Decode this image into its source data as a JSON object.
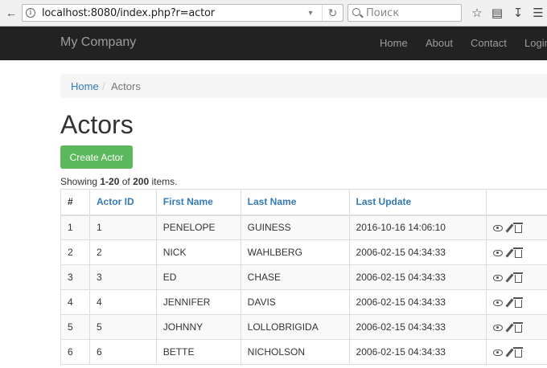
{
  "browser": {
    "url": "localhost:8080/index.php?r=actor",
    "search_placeholder": "Поиск"
  },
  "navbar": {
    "brand": "My Company",
    "links": [
      "Home",
      "About",
      "Contact",
      "Login"
    ]
  },
  "breadcrumb": {
    "home": "Home",
    "separator": "/",
    "active": "Actors"
  },
  "page": {
    "title": "Actors",
    "create_button": "Create Actor"
  },
  "summary": {
    "prefix": "Showing ",
    "range": "1-20",
    "middle": " of ",
    "total": "200",
    "suffix": " items."
  },
  "table": {
    "headers": [
      "#",
      "Actor ID",
      "First Name",
      "Last Name",
      "Last Update",
      ""
    ],
    "rows": [
      [
        "1",
        "1",
        "PENELOPE",
        "GUINESS",
        "2016-10-16 14:06:10"
      ],
      [
        "2",
        "2",
        "NICK",
        "WAHLBERG",
        "2006-02-15 04:34:33"
      ],
      [
        "3",
        "3",
        "ED",
        "CHASE",
        "2006-02-15 04:34:33"
      ],
      [
        "4",
        "4",
        "JENNIFER",
        "DAVIS",
        "2006-02-15 04:34:33"
      ],
      [
        "5",
        "5",
        "JOHNNY",
        "LOLLOBRIGIDA",
        "2006-02-15 04:34:33"
      ],
      [
        "6",
        "6",
        "BETTE",
        "NICHOLSON",
        "2006-02-15 04:34:33"
      ]
    ],
    "row_actions": [
      "view-icon",
      "update-icon",
      "delete-icon"
    ]
  },
  "colors": {
    "navbar_bg": "#222222",
    "nav_text": "#9d9d9d",
    "link": "#337ab7",
    "success_button": "#5cb85c",
    "stripe": "#f9f9f9"
  }
}
